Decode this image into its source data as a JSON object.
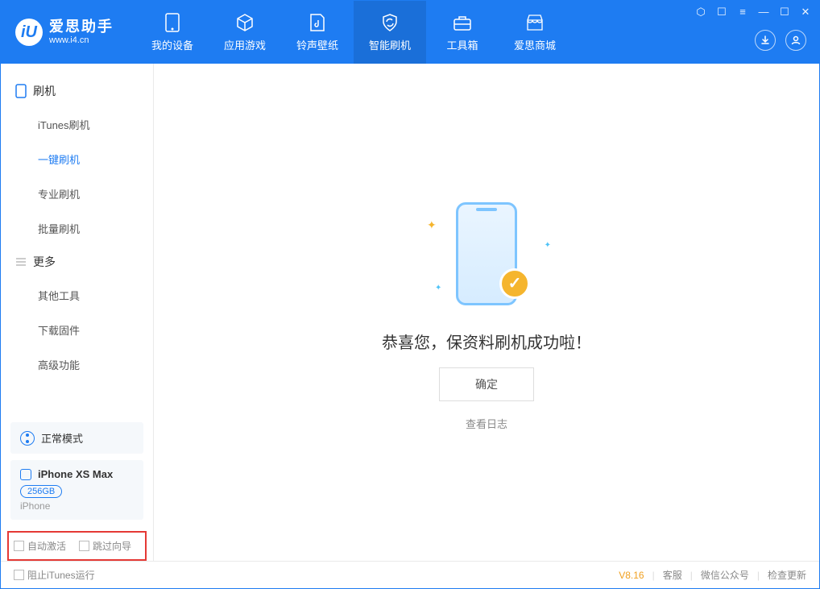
{
  "app": {
    "title": "爱思助手",
    "subtitle": "www.i4.cn",
    "logo_letter": "iU"
  },
  "header_tabs": {
    "device": "我的设备",
    "apps": "应用游戏",
    "ringtone": "铃声壁纸",
    "flash": "智能刷机",
    "toolbox": "工具箱",
    "store": "爱思商城"
  },
  "sidebar": {
    "section_flash": "刷机",
    "items": {
      "itunes": "iTunes刷机",
      "oneclick": "一键刷机",
      "pro": "专业刷机",
      "batch": "批量刷机"
    },
    "section_more": "更多",
    "more": {
      "other": "其他工具",
      "firmware": "下载固件",
      "advanced": "高级功能"
    }
  },
  "mode": {
    "label": "正常模式"
  },
  "device": {
    "name": "iPhone XS Max",
    "storage": "256GB",
    "type": "iPhone"
  },
  "options": {
    "auto_activate": "自动激活",
    "skip_guide": "跳过向导"
  },
  "main": {
    "success": "恭喜您，保资料刷机成功啦！",
    "confirm": "确定",
    "view_log": "查看日志"
  },
  "status": {
    "block_itunes": "阻止iTunes运行",
    "version": "V8.16",
    "support": "客服",
    "wechat": "微信公众号",
    "update": "检查更新"
  }
}
